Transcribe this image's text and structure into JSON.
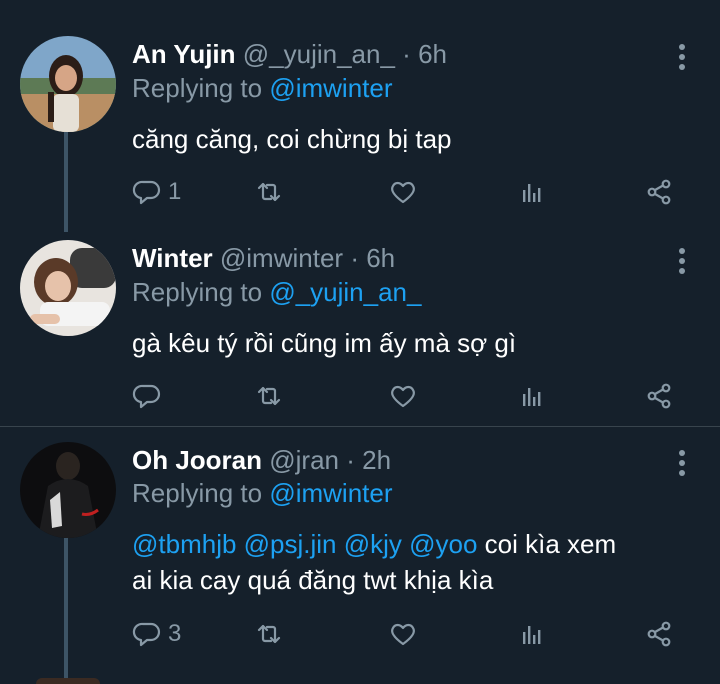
{
  "tweets": [
    {
      "name": "An Yujin",
      "handle": "@_yujin_an_",
      "dot": "·",
      "time": "6h",
      "replying_prefix": "Replying to",
      "replying_to": "@imwinter",
      "text": "căng căng, coi chừng bị tap",
      "reply_count": "1",
      "retweet_count": "",
      "like_count": ""
    },
    {
      "name": "Winter",
      "handle": "@imwinter",
      "dot": "·",
      "time": "6h",
      "replying_prefix": "Replying to",
      "replying_to": "@_yujin_an_",
      "text": "gà kêu tý rồi cũng im ấy mà sợ gì",
      "reply_count": "",
      "retweet_count": "",
      "like_count": ""
    },
    {
      "name": "Oh Jooran",
      "handle": "@jran",
      "dot": "·",
      "time": "2h",
      "replying_prefix": "Replying to",
      "replying_to": "@imwinter",
      "mentions": "@tbmhjb @psj.jin @kjy @yoo",
      "text_after_mentions": " coi kìa xem",
      "text_line2": "ai kia cay quá đăng twt khịa kìa",
      "reply_count": "3",
      "retweet_count": "",
      "like_count": ""
    }
  ],
  "icons": {
    "reply": "reply-icon",
    "retweet": "retweet-icon",
    "like": "heart-icon",
    "analytics": "analytics-icon",
    "share": "share-icon",
    "more": "more-vertical-icon"
  },
  "colors": {
    "background": "#15202b",
    "text": "#ffffff",
    "secondary": "#8899a6",
    "link": "#1da1f2",
    "thread_line": "#3d5466",
    "divider": "#38444d"
  }
}
